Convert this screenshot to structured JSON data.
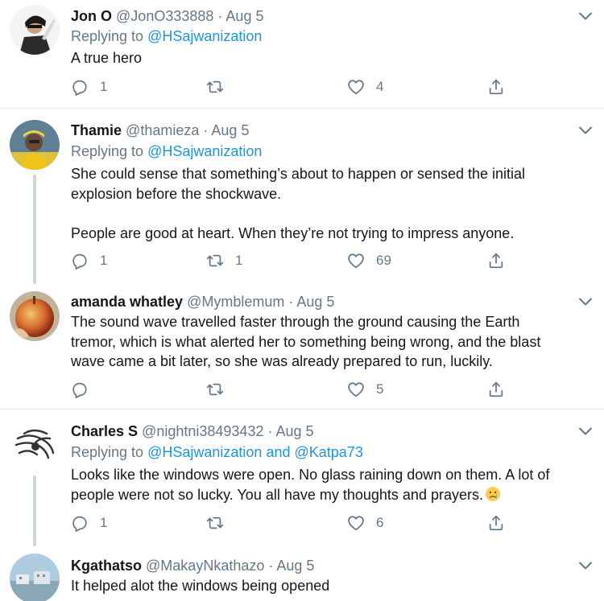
{
  "reply_prefix": "Replying to",
  "dot": "·",
  "tweets": [
    {
      "name": "Jon O",
      "handle": "@JonO333888",
      "date": "Aug 5",
      "reply_to": "@HSajwanization",
      "lines": [
        "A true hero"
      ],
      "replies": "1",
      "retweets": "",
      "likes": "4"
    },
    {
      "name": "Thamie",
      "handle": "@thamieza",
      "date": "Aug 5",
      "reply_to": "@HSajwanization",
      "lines": [
        "She could sense that something’s about to happen or sensed the initial",
        "explosion before the shockwave.",
        "People are good at heart. When they’re not trying to impress anyone."
      ],
      "replies": "1",
      "retweets": "1",
      "likes": "69"
    },
    {
      "name": "amanda whatley",
      "handle": "@Mymblemum",
      "date": "Aug 5",
      "lines": [
        "The sound wave travelled faster through the ground causing the Earth",
        "tremor, which is what alerted her to something being wrong, and the blast",
        "wave came a bit later, so she was already prepared to run, luckily."
      ],
      "replies": "",
      "retweets": "",
      "likes": "5"
    },
    {
      "name": "Charles S",
      "handle": "@nightni38493432",
      "date": "Aug 5",
      "reply_to": "@HSajwanization",
      "reply_and": "and",
      "reply_to_2": "@Katpa73",
      "lines": [
        "Looks like the windows were open. No glass raining down on them. A lot of",
        "people were not so lucky. You all have my thoughts and prayers."
      ],
      "emoji": "crying-face",
      "replies": "1",
      "retweets": "",
      "likes": "6"
    },
    {
      "name": "Kgathatso",
      "handle": "@MakayNkathazo",
      "date": "Aug 5",
      "lines": [
        "It helped alot the windows being opened"
      ]
    }
  ],
  "icons": {
    "reply": "reply-icon",
    "retweet": "retweet-icon",
    "like": "heart-icon",
    "share": "share-icon",
    "menu": "chevron-down-icon"
  },
  "colors": {
    "link": "#1b95e0",
    "secondary": "#657786",
    "divider": "#e6ecf0",
    "thread_line": "#ccd6dd"
  }
}
